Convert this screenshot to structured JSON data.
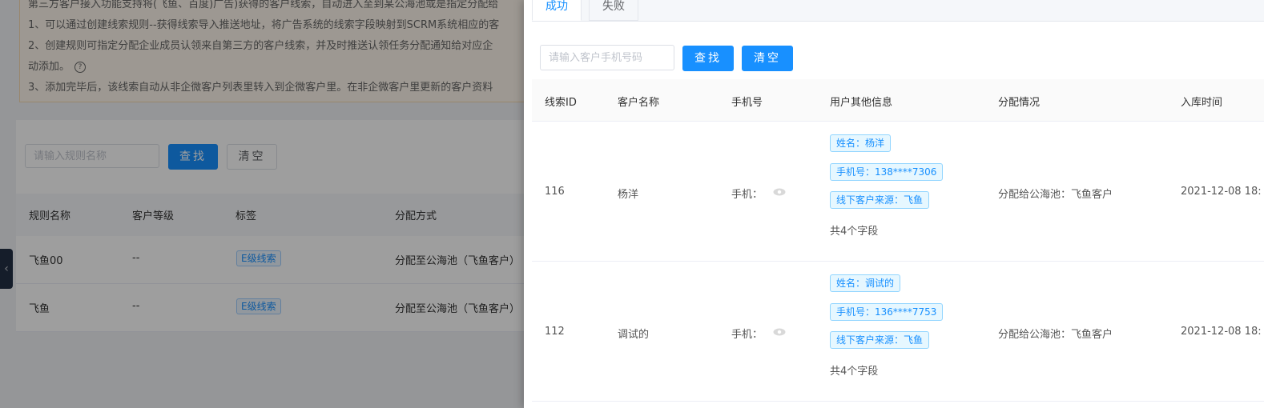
{
  "notice": {
    "line0": "第三方客户接入功能支持将(飞鱼、百度)广告)获得的客户线索，自动进入至到某公海池或是指定分配给",
    "line1": "1、可以通过创建线索规则--获得线索导入推送地址，将广告系统的线索字段映射到SCRM系统相应的客",
    "line2": "2、创建规则可指定分配企业成员认领来自第三方的客户线索，并及时推送认领任务分配通知给对应企",
    "line3": "动添加。",
    "line4": "3、添加完毕后，该线索自动从非企微客户列表里转入到企微客户里。在非企微客户里更新的客户资料"
  },
  "rule_search": {
    "placeholder": "请输入规则名称",
    "search_label": "查找",
    "clear_label": "清空"
  },
  "rules_table": {
    "columns": [
      "规则名称",
      "客户等级",
      "标签",
      "分配方式"
    ],
    "rows": [
      {
        "name": "飞鱼00",
        "level": "--",
        "tag": "E级线索",
        "method": "分配至公海池（飞鱼客户）"
      },
      {
        "name": "飞鱼",
        "level": "--",
        "tag": "E级线索",
        "method": "分配至公海池（飞鱼客户）"
      }
    ]
  },
  "drawer": {
    "tabs": [
      "成功",
      "失败"
    ],
    "search": {
      "placeholder": "请输入客户手机号码",
      "search_label": "查找",
      "clear_label": "清空"
    },
    "columns": [
      "线索ID",
      "客户名称",
      "手机号",
      "用户其他信息",
      "分配情况",
      "入库时间"
    ],
    "rows": [
      {
        "id": "116",
        "name": "杨洋",
        "phone_label": "手机：",
        "info": [
          "姓名：杨洋",
          "手机号：138****7306",
          "线下客户来源：飞鱼"
        ],
        "field_count": "共4个字段",
        "assign": "分配给公海池：飞鱼客户",
        "time": "2021-12-08 18:"
      },
      {
        "id": "112",
        "name": "调试的",
        "phone_label": "手机：",
        "info": [
          "姓名：调试的",
          "手机号：136****7753",
          "线下客户来源：飞鱼"
        ],
        "field_count": "共4个字段",
        "assign": "分配给公海池：飞鱼客户",
        "time": "2021-12-08 18:"
      }
    ]
  },
  "colors": {
    "primary": "#1890ff",
    "mask": "rgba(0,0,0,0.38)",
    "notice_bg": "#fdf6ec"
  },
  "icons": {
    "help": "question-circle-icon",
    "eye": "eye-icon",
    "collapse": "chevron-left-icon"
  }
}
